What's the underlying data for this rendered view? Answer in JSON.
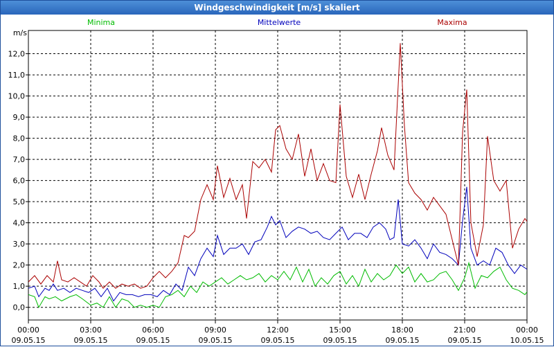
{
  "window": {
    "title": "Windgeschwindigkeit [m/s] skaliert"
  },
  "colors": {
    "minima": "#00bb00",
    "mittel": "#0000bb",
    "maxima": "#aa0000",
    "grid": "#000000"
  },
  "chart_data": {
    "type": "line",
    "title": "Windgeschwindigkeit [m/s] skaliert",
    "ylabel": "m/s",
    "xlabel": "",
    "ylim": [
      -0.6,
      13.1
    ],
    "yticks": [
      {
        "value": 0,
        "label": "0,0"
      },
      {
        "value": 1,
        "label": "1,0"
      },
      {
        "value": 2,
        "label": "2,0"
      },
      {
        "value": 3,
        "label": "3,0"
      },
      {
        "value": 4,
        "label": "4,0"
      },
      {
        "value": 5,
        "label": "5,0"
      },
      {
        "value": 6,
        "label": "6,0"
      },
      {
        "value": 7,
        "label": "7,0"
      },
      {
        "value": 8,
        "label": "8,0"
      },
      {
        "value": 9,
        "label": "9,0"
      },
      {
        "value": 10,
        "label": "10,0"
      },
      {
        "value": 11,
        "label": "11,0"
      },
      {
        "value": 12,
        "label": "12,0"
      }
    ],
    "xlim": [
      0,
      24
    ],
    "xticks": [
      {
        "value": 0,
        "time": "00:00",
        "date": "09.05.15"
      },
      {
        "value": 3,
        "time": "03:00",
        "date": "09.05.15"
      },
      {
        "value": 6,
        "time": "06:00",
        "date": "09.05.15"
      },
      {
        "value": 9,
        "time": "09:00",
        "date": "09.05.15"
      },
      {
        "value": 12,
        "time": "12:00",
        "date": "09.05.15"
      },
      {
        "value": 15,
        "time": "15:00",
        "date": "09.05.15"
      },
      {
        "value": 18,
        "time": "18:00",
        "date": "09.05.15"
      },
      {
        "value": 21,
        "time": "21:00",
        "date": "09.05.15"
      },
      {
        "value": 24,
        "time": "00:00",
        "date": "10.05.15"
      }
    ],
    "grid": true,
    "legend": "top",
    "series": [
      {
        "name": "Minima",
        "color": "#00bb00",
        "points": [
          [
            0,
            0.6
          ],
          [
            0.3,
            0.5
          ],
          [
            0.5,
            0.0
          ],
          [
            0.8,
            0.5
          ],
          [
            1.0,
            0.4
          ],
          [
            1.3,
            0.5
          ],
          [
            1.6,
            0.3
          ],
          [
            2.0,
            0.5
          ],
          [
            2.3,
            0.6
          ],
          [
            2.6,
            0.4
          ],
          [
            3.0,
            0.1
          ],
          [
            3.3,
            0.2
          ],
          [
            3.6,
            0.0
          ],
          [
            3.9,
            0.5
          ],
          [
            4.2,
            0.0
          ],
          [
            4.5,
            0.4
          ],
          [
            4.8,
            0.3
          ],
          [
            5.1,
            0.0
          ],
          [
            5.4,
            0.1
          ],
          [
            5.7,
            0.0
          ],
          [
            6.0,
            0.1
          ],
          [
            6.3,
            0.0
          ],
          [
            6.6,
            0.5
          ],
          [
            6.9,
            0.6
          ],
          [
            7.2,
            0.8
          ],
          [
            7.5,
            0.5
          ],
          [
            7.8,
            1.0
          ],
          [
            8.1,
            0.7
          ],
          [
            8.4,
            1.2
          ],
          [
            8.7,
            1.0
          ],
          [
            9.0,
            1.2
          ],
          [
            9.3,
            1.4
          ],
          [
            9.6,
            1.1
          ],
          [
            9.9,
            1.3
          ],
          [
            10.2,
            1.5
          ],
          [
            10.5,
            1.3
          ],
          [
            10.8,
            1.4
          ],
          [
            11.1,
            1.6
          ],
          [
            11.4,
            1.2
          ],
          [
            11.7,
            1.5
          ],
          [
            12.0,
            1.3
          ],
          [
            12.3,
            1.7
          ],
          [
            12.6,
            1.3
          ],
          [
            12.9,
            1.9
          ],
          [
            13.2,
            1.2
          ],
          [
            13.5,
            1.8
          ],
          [
            13.8,
            1.0
          ],
          [
            14.1,
            1.4
          ],
          [
            14.4,
            1.1
          ],
          [
            14.7,
            1.5
          ],
          [
            15.0,
            1.7
          ],
          [
            15.3,
            1.1
          ],
          [
            15.6,
            1.5
          ],
          [
            15.9,
            1.0
          ],
          [
            16.2,
            1.8
          ],
          [
            16.5,
            1.2
          ],
          [
            16.8,
            1.6
          ],
          [
            17.1,
            1.3
          ],
          [
            17.4,
            1.5
          ],
          [
            17.7,
            2.0
          ],
          [
            18.0,
            1.6
          ],
          [
            18.3,
            1.9
          ],
          [
            18.6,
            1.2
          ],
          [
            18.9,
            1.6
          ],
          [
            19.2,
            1.2
          ],
          [
            19.5,
            1.3
          ],
          [
            19.8,
            1.6
          ],
          [
            20.1,
            1.7
          ],
          [
            20.4,
            1.3
          ],
          [
            20.7,
            0.8
          ],
          [
            21.0,
            1.4
          ],
          [
            21.2,
            2.1
          ],
          [
            21.5,
            0.9
          ],
          [
            21.8,
            1.5
          ],
          [
            22.1,
            1.4
          ],
          [
            22.4,
            1.7
          ],
          [
            22.7,
            1.9
          ],
          [
            23.0,
            1.3
          ],
          [
            23.3,
            0.9
          ],
          [
            23.6,
            0.8
          ],
          [
            23.9,
            0.6
          ],
          [
            24.2,
            1.0
          ],
          [
            24.4,
            1.3
          ]
        ]
      },
      {
        "name": "Mittelwerte",
        "color": "#0000bb",
        "points": [
          [
            0,
            0.9
          ],
          [
            0.3,
            1.0
          ],
          [
            0.5,
            0.5
          ],
          [
            0.8,
            0.9
          ],
          [
            1.0,
            0.8
          ],
          [
            1.2,
            1.1
          ],
          [
            1.4,
            0.8
          ],
          [
            1.7,
            0.9
          ],
          [
            2.0,
            0.7
          ],
          [
            2.3,
            0.9
          ],
          [
            2.6,
            0.8
          ],
          [
            2.9,
            0.7
          ],
          [
            3.2,
            0.9
          ],
          [
            3.5,
            0.5
          ],
          [
            3.8,
            0.9
          ],
          [
            4.1,
            0.3
          ],
          [
            4.4,
            0.7
          ],
          [
            4.7,
            0.6
          ],
          [
            5.0,
            0.6
          ],
          [
            5.3,
            0.5
          ],
          [
            5.6,
            0.6
          ],
          [
            5.9,
            0.6
          ],
          [
            6.2,
            0.5
          ],
          [
            6.5,
            0.8
          ],
          [
            6.8,
            0.6
          ],
          [
            7.1,
            1.1
          ],
          [
            7.4,
            0.8
          ],
          [
            7.7,
            1.9
          ],
          [
            8.0,
            1.5
          ],
          [
            8.3,
            2.3
          ],
          [
            8.6,
            2.8
          ],
          [
            8.9,
            2.4
          ],
          [
            9.1,
            3.4
          ],
          [
            9.4,
            2.5
          ],
          [
            9.7,
            2.8
          ],
          [
            10.0,
            2.8
          ],
          [
            10.3,
            3.0
          ],
          [
            10.6,
            2.5
          ],
          [
            10.9,
            3.1
          ],
          [
            11.2,
            3.2
          ],
          [
            11.5,
            3.8
          ],
          [
            11.7,
            4.3
          ],
          [
            11.9,
            3.9
          ],
          [
            12.1,
            4.1
          ],
          [
            12.4,
            3.3
          ],
          [
            12.7,
            3.6
          ],
          [
            13.0,
            3.8
          ],
          [
            13.3,
            3.7
          ],
          [
            13.6,
            3.5
          ],
          [
            13.9,
            3.6
          ],
          [
            14.2,
            3.3
          ],
          [
            14.5,
            3.2
          ],
          [
            14.8,
            3.5
          ],
          [
            15.1,
            3.8
          ],
          [
            15.4,
            3.2
          ],
          [
            15.7,
            3.5
          ],
          [
            16.0,
            3.5
          ],
          [
            16.3,
            3.3
          ],
          [
            16.6,
            3.8
          ],
          [
            16.9,
            4.0
          ],
          [
            17.2,
            3.7
          ],
          [
            17.4,
            3.2
          ],
          [
            17.6,
            3.3
          ],
          [
            17.8,
            5.1
          ],
          [
            18.0,
            3.0
          ],
          [
            18.3,
            2.9
          ],
          [
            18.6,
            3.2
          ],
          [
            18.9,
            2.8
          ],
          [
            19.2,
            2.3
          ],
          [
            19.5,
            3.0
          ],
          [
            19.8,
            2.6
          ],
          [
            20.1,
            2.5
          ],
          [
            20.4,
            2.3
          ],
          [
            20.7,
            2.0
          ],
          [
            20.9,
            4.1
          ],
          [
            21.1,
            5.7
          ],
          [
            21.3,
            2.8
          ],
          [
            21.6,
            2.0
          ],
          [
            21.9,
            2.2
          ],
          [
            22.2,
            2.0
          ],
          [
            22.5,
            2.8
          ],
          [
            22.8,
            2.6
          ],
          [
            23.1,
            2.0
          ],
          [
            23.4,
            1.6
          ],
          [
            23.7,
            2.0
          ],
          [
            24.0,
            1.8
          ],
          [
            24.3,
            2.1
          ],
          [
            24.5,
            2.6
          ]
        ]
      },
      {
        "name": "Maxima",
        "color": "#aa0000",
        "points": [
          [
            0,
            1.2
          ],
          [
            0.3,
            1.5
          ],
          [
            0.6,
            1.1
          ],
          [
            0.9,
            1.5
          ],
          [
            1.2,
            1.2
          ],
          [
            1.4,
            2.2
          ],
          [
            1.6,
            1.3
          ],
          [
            1.9,
            1.2
          ],
          [
            2.2,
            1.4
          ],
          [
            2.5,
            1.2
          ],
          [
            2.8,
            1.0
          ],
          [
            3.1,
            1.5
          ],
          [
            3.4,
            1.2
          ],
          [
            3.6,
            0.9
          ],
          [
            3.9,
            1.2
          ],
          [
            4.2,
            0.9
          ],
          [
            4.5,
            1.1
          ],
          [
            4.8,
            1.0
          ],
          [
            5.1,
            1.1
          ],
          [
            5.4,
            0.9
          ],
          [
            5.7,
            1.0
          ],
          [
            6.0,
            1.4
          ],
          [
            6.3,
            1.7
          ],
          [
            6.6,
            1.4
          ],
          [
            6.9,
            1.7
          ],
          [
            7.2,
            2.1
          ],
          [
            7.5,
            3.4
          ],
          [
            7.7,
            3.3
          ],
          [
            8.0,
            3.6
          ],
          [
            8.3,
            5.1
          ],
          [
            8.6,
            5.8
          ],
          [
            8.9,
            5.1
          ],
          [
            9.1,
            6.7
          ],
          [
            9.4,
            5.2
          ],
          [
            9.7,
            6.1
          ],
          [
            10.0,
            5.1
          ],
          [
            10.3,
            5.8
          ],
          [
            10.5,
            4.2
          ],
          [
            10.8,
            6.9
          ],
          [
            11.1,
            6.6
          ],
          [
            11.4,
            7.0
          ],
          [
            11.7,
            6.4
          ],
          [
            11.9,
            8.4
          ],
          [
            12.1,
            8.6
          ],
          [
            12.4,
            7.5
          ],
          [
            12.7,
            7.0
          ],
          [
            13.0,
            8.2
          ],
          [
            13.3,
            6.2
          ],
          [
            13.6,
            7.5
          ],
          [
            13.9,
            6.0
          ],
          [
            14.2,
            6.8
          ],
          [
            14.5,
            6.0
          ],
          [
            14.8,
            5.9
          ],
          [
            15.0,
            9.6
          ],
          [
            15.3,
            6.2
          ],
          [
            15.6,
            5.2
          ],
          [
            15.9,
            6.3
          ],
          [
            16.2,
            5.1
          ],
          [
            16.5,
            6.3
          ],
          [
            16.8,
            7.4
          ],
          [
            17.0,
            8.5
          ],
          [
            17.3,
            7.2
          ],
          [
            17.6,
            6.5
          ],
          [
            17.9,
            12.5
          ],
          [
            18.1,
            8.6
          ],
          [
            18.3,
            5.9
          ],
          [
            18.6,
            5.4
          ],
          [
            18.9,
            5.1
          ],
          [
            19.2,
            4.6
          ],
          [
            19.5,
            5.2
          ],
          [
            19.8,
            4.8
          ],
          [
            20.1,
            4.4
          ],
          [
            20.4,
            3.2
          ],
          [
            20.7,
            2.0
          ],
          [
            20.9,
            8.3
          ],
          [
            21.1,
            10.3
          ],
          [
            21.3,
            4.0
          ],
          [
            21.6,
            2.4
          ],
          [
            21.9,
            3.9
          ],
          [
            22.1,
            8.1
          ],
          [
            22.4,
            6.0
          ],
          [
            22.7,
            5.5
          ],
          [
            23.0,
            6.0
          ],
          [
            23.3,
            2.8
          ],
          [
            23.6,
            3.7
          ],
          [
            23.9,
            4.2
          ],
          [
            24.2,
            3.8
          ],
          [
            24.4,
            4.8
          ],
          [
            24.6,
            5.3
          ]
        ]
      }
    ]
  }
}
